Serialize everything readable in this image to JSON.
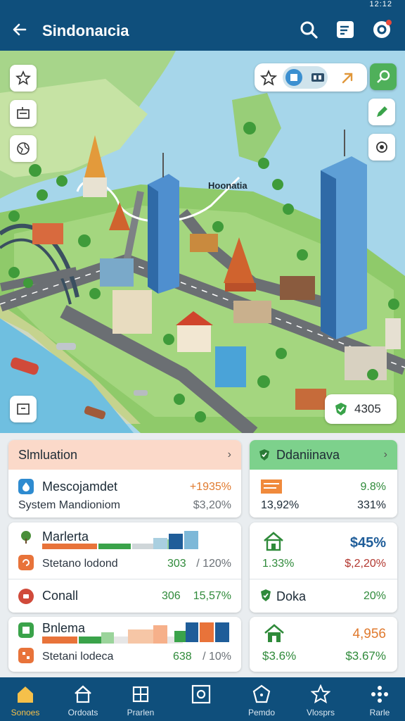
{
  "status": {
    "time": "12:12"
  },
  "header": {
    "title": "Sindonaıcia"
  },
  "map": {
    "city_label": "Hoonatia",
    "score_chip": "4305"
  },
  "cards": {
    "simulation": {
      "title": "Slmluation",
      "row1": {
        "title": "Mescojamdet",
        "value": "+1935%",
        "sub": "System Mandioniom",
        "sub_value": "$3,20%"
      },
      "row2": {
        "title": "Marlerta"
      },
      "row3": {
        "sub": "Stetano lodond",
        "v1": "303",
        "v2": "/ 120%"
      },
      "row4": {
        "title": "Conall",
        "v1": "306",
        "v2": "15,57%"
      },
      "row5": {
        "title": "Bnlema"
      },
      "row6": {
        "sub": "Stetani lodeca",
        "v1": "638",
        "v2": "/ 10%"
      }
    },
    "summary": {
      "title": "Ddaniinava",
      "row1": {
        "value": "9.8%",
        "a": "13,92%",
        "b": "331%"
      },
      "row2": {
        "value": "$45%",
        "a": "1.33%",
        "b": "$,2,20%"
      },
      "row3": {
        "title": "Doka",
        "value": "20%"
      },
      "row4": {
        "value": "4,956",
        "a": "$3.6%",
        "b": "$3.67%"
      }
    }
  },
  "nav": [
    {
      "label": "Sonoes",
      "icon": "home-icon"
    },
    {
      "label": "Ordoats",
      "icon": "house-icon"
    },
    {
      "label": "Prarlen",
      "icon": "grid-icon"
    },
    {
      "label": "",
      "icon": "frame-icon"
    },
    {
      "label": "Pemdo",
      "icon": "pentagon-icon"
    },
    {
      "label": "Vlosprs",
      "icon": "star-icon"
    },
    {
      "label": "Rarle",
      "icon": "dots-icon"
    }
  ],
  "chart_colors": {
    "orange": "#e8733a",
    "green": "#3aa34a",
    "blue": "#1f5d99",
    "header_bg": "#0f4f7c"
  }
}
